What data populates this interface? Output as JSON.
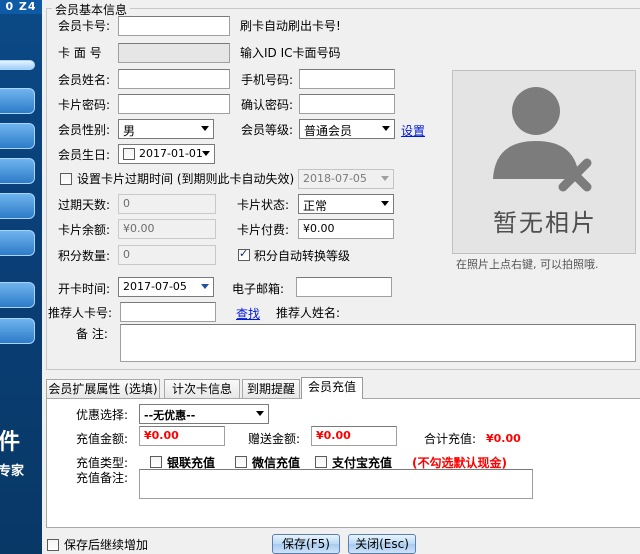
{
  "sidebar": {
    "top_text": "0 Z4",
    "logo_text": "件",
    "sub_text": "专家"
  },
  "group_title": "会员基本信息",
  "fields": {
    "card_no_label": "会员卡号:",
    "card_no_hint": "刷卡自动刷出卡号!",
    "card_face_label": "卡 面 号",
    "card_face_hint": "输入ID IC卡面号码",
    "name_label": "会员姓名:",
    "phone_label": "手机号码:",
    "password_label": "卡片密码:",
    "confirm_label": "确认密码:",
    "gender_label": "会员性别:",
    "gender_value": "男",
    "level_label": "会员等级:",
    "level_value": "普通会员",
    "level_setting_link": "设置",
    "birthday_label": "会员生日:",
    "birthday_value": "2017-01-01",
    "expire_check_label": "设置卡片过期时间 (到期则此卡自动失效)",
    "expire_date_value": "2018-07-05",
    "expire_days_label": "过期天数:",
    "expire_days_value": "0",
    "card_status_label": "卡片状态:",
    "card_status_value": "正常",
    "balance_label": "卡片余额:",
    "balance_value": "¥0.00",
    "fee_label": "卡片付费:",
    "fee_value": "¥0.00",
    "points_label": "积分数量:",
    "points_value": "0",
    "auto_level_label": "积分自动转换等级",
    "open_date_label": "开卡时间:",
    "open_date_value": "2017-07-05",
    "email_label": "电子邮箱:",
    "referrer_label": "推荐人卡号:",
    "lookup_link": "查找",
    "referrer_name_label": "推荐人姓名:",
    "remark_label": "备 注:"
  },
  "photo": {
    "caption": "暂无相片",
    "hint": "在照片上点右键, 可以拍照哦."
  },
  "tabs": [
    {
      "label": "会员扩展属性 (选填)"
    },
    {
      "label": "计次卡信息"
    },
    {
      "label": "到期提醒"
    },
    {
      "label": "会员充值"
    }
  ],
  "recharge": {
    "discount_label": "优惠选择:",
    "discount_value": "--无优惠--",
    "amount_label": "充值金额:",
    "amount_value": "¥0.00",
    "gift_label": "赠送金额:",
    "gift_value": "¥0.00",
    "total_label": "合计充值:",
    "total_value": "¥0.00",
    "type_label": "充值类型:",
    "type_unionpay": "银联充值",
    "type_wechat": "微信充值",
    "type_alipay": "支付宝充值",
    "type_note": "(不勾选默认现金)",
    "remark_label": "充值备注:"
  },
  "footer": {
    "continue_label": "保存后继续增加",
    "save_button": "保存(F5)",
    "close_button": "关闭(Esc)"
  },
  "colors": {
    "accent_red": "#ff0000",
    "link_blue": "#0018d8",
    "sidebar_blue": "#0a3f78"
  }
}
